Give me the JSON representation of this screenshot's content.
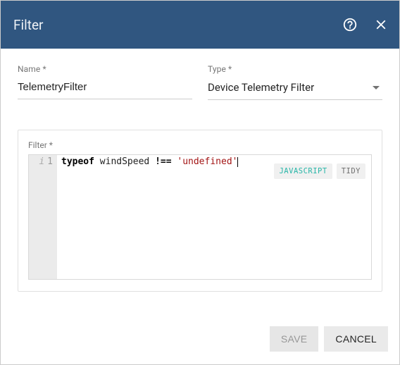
{
  "header": {
    "title": "Filter"
  },
  "fields": {
    "name": {
      "label": "Name *",
      "value": "TelemetryFilter"
    },
    "type": {
      "label": "Type *",
      "value": "Device Telemetry Filter"
    }
  },
  "filter": {
    "label": "Filter *",
    "lineNumber": "1",
    "code": {
      "kw": "typeof",
      "mid": " windSpeed ",
      "op": "!==",
      "sp": " ",
      "str": "'undefined'"
    },
    "badges": {
      "js": "JAVASCRIPT",
      "tidy": "TIDY"
    }
  },
  "actions": {
    "save": "SAVE",
    "cancel": "CANCEL"
  }
}
